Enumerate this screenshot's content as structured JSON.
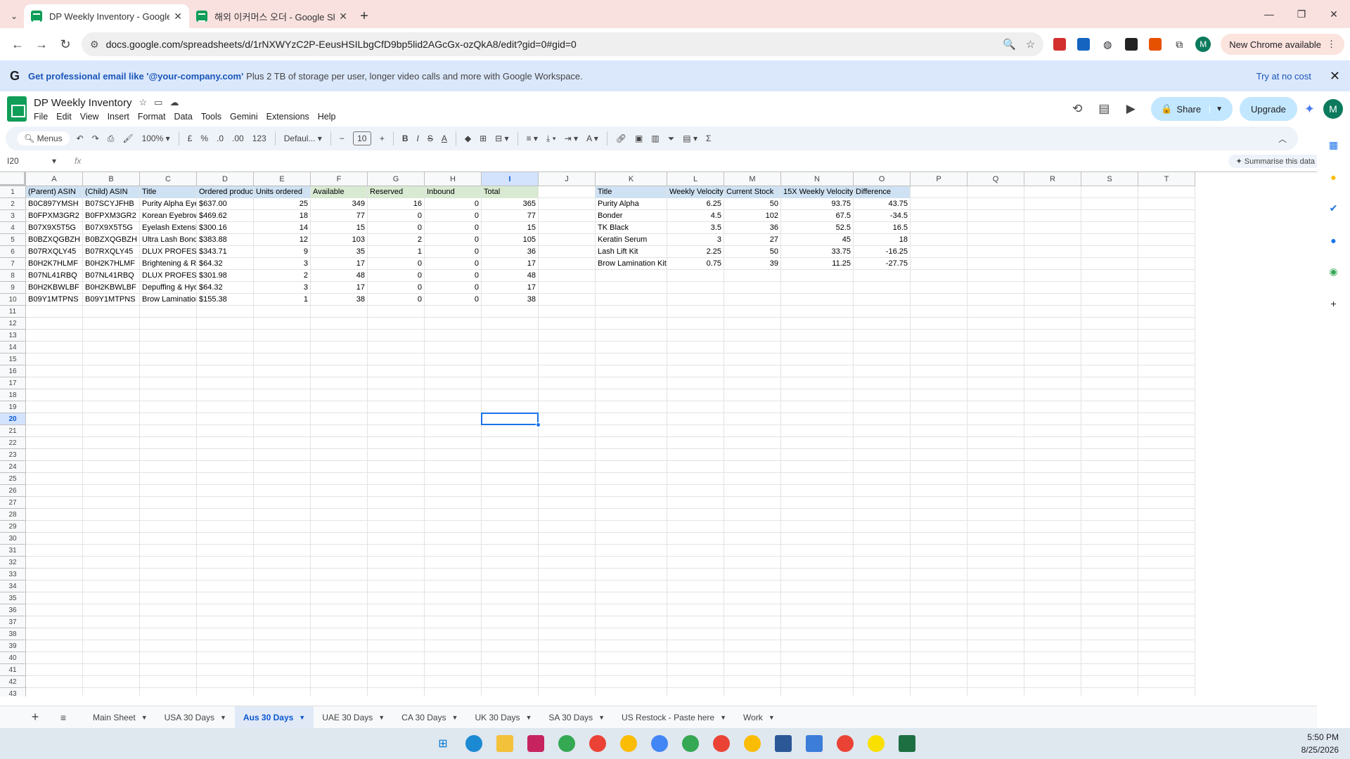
{
  "browser": {
    "tabs": [
      {
        "title": "DP Weekly Inventory - Google S",
        "active": true
      },
      {
        "title": "해외 이커머스 오더 - Google Sh",
        "active": false
      }
    ],
    "url": "docs.google.com/spreadsheets/d/1rNXWYzC2P-EeusHSILbgCfD9bp5lid2AGcGx-ozQkA8/edit?gid=0#gid=0",
    "profile_initial": "M",
    "new_chrome": "New Chrome available"
  },
  "promo": {
    "logo": "G",
    "bold": "Get professional email like '@your-company.com'",
    "text": "Plus 2 TB of storage per user, longer video calls and more with Google Workspace.",
    "cta": "Try at no cost"
  },
  "doc": {
    "title": "DP Weekly Inventory",
    "menu": [
      "File",
      "Edit",
      "View",
      "Insert",
      "Format",
      "Data",
      "Tools",
      "Gemini",
      "Extensions",
      "Help"
    ],
    "share": "Share",
    "upgrade": "Upgrade",
    "avatar": "M"
  },
  "toolbar": {
    "menus": "Menus",
    "zoom": "100%",
    "currency": "£",
    "percent": "%",
    "dec_dec": ".0",
    "dec_inc": ".00",
    "num_fmt": "123",
    "font": "Defaul...",
    "font_size": "10"
  },
  "formula_bar": {
    "name_box": "I20",
    "summarise": "Summarise this data"
  },
  "columns": [
    "A",
    "B",
    "C",
    "D",
    "E",
    "F",
    "G",
    "H",
    "I",
    "J",
    "K",
    "L",
    "M",
    "N",
    "O",
    "P",
    "Q",
    "R",
    "S",
    "T"
  ],
  "selected_col": "I",
  "selected_row": 20,
  "rows_count": 43,
  "headers": {
    "A": "(Parent) ASIN",
    "B": "(Child) ASIN",
    "C": "Title",
    "D": "Ordered product",
    "E": "Units ordered",
    "F": "Available",
    "G": "Reserved",
    "H": "Inbound",
    "I": "Total",
    "K": "Title",
    "L": "Weekly Velocity",
    "M": "Current Stock",
    "N": "15X Weekly Velocity",
    "O": "Difference"
  },
  "table1": [
    [
      "B0C897YMSH",
      "B07SCYJFHB",
      "Purity Alpha Eye",
      "$637.00",
      "25",
      "349",
      "16",
      "0",
      "365"
    ],
    [
      "B0FPXM3GR2",
      "B0FPXM3GR2",
      "Korean Eyebrow",
      "$469.62",
      "18",
      "77",
      "0",
      "0",
      "77"
    ],
    [
      "B07X9X5T5G",
      "B07X9X5T5G",
      "Eyelash Extensi",
      "$300.16",
      "14",
      "15",
      "0",
      "0",
      "15"
    ],
    [
      "B0BZXQGBZH",
      "B0BZXQGBZH",
      "Ultra Lash Bond",
      "$383.88",
      "12",
      "103",
      "2",
      "0",
      "105"
    ],
    [
      "B07RXQLY45",
      "B07RXQLY45",
      "DLUX PROFESS",
      "$343.71",
      "9",
      "35",
      "1",
      "0",
      "36"
    ],
    [
      "B0H2K7HLMF",
      "B0H2K7HLMF",
      "Brightening & Re",
      "$64.32",
      "3",
      "17",
      "0",
      "0",
      "17"
    ],
    [
      "B07NL41RBQ",
      "B07NL41RBQ",
      "DLUX PROFESS",
      "$301.98",
      "2",
      "48",
      "0",
      "0",
      "48"
    ],
    [
      "B0H2KBWLBF",
      "B0H2KBWLBF",
      "Depuffing & Hyd",
      "$64.32",
      "3",
      "17",
      "0",
      "0",
      "17"
    ],
    [
      "B09Y1MTPNS",
      "B09Y1MTPNS",
      "Brow Lamination",
      "$155.38",
      "1",
      "38",
      "0",
      "0",
      "38"
    ]
  ],
  "table2": [
    [
      "Purity Alpha",
      "6.25",
      "50",
      "93.75",
      "43.75"
    ],
    [
      "Bonder",
      "4.5",
      "102",
      "67.5",
      "-34.5"
    ],
    [
      "TK Black",
      "3.5",
      "36",
      "52.5",
      "16.5"
    ],
    [
      "Keratin Serum",
      "3",
      "27",
      "45",
      "18"
    ],
    [
      "Lash Lift Kit",
      "2.25",
      "50",
      "33.75",
      "-16.25"
    ],
    [
      "Brow Lamination Kit",
      "0.75",
      "39",
      "11.25",
      "-27.75"
    ]
  ],
  "colors": {
    "header_blue": "#cfe2f3",
    "header_green": "#d9ead3",
    "selection": "#1a73e8"
  },
  "sheets": [
    {
      "name": "Main Sheet",
      "active": false
    },
    {
      "name": "USA 30 Days",
      "active": false
    },
    {
      "name": "Aus 30 Days",
      "active": true
    },
    {
      "name": "UAE 30 Days",
      "active": false
    },
    {
      "name": "CA 30 Days",
      "active": false
    },
    {
      "name": "UK 30 Days",
      "active": false
    },
    {
      "name": "SA 30 Days",
      "active": false
    },
    {
      "name": "US Restock - Paste here",
      "active": false
    },
    {
      "name": "Work",
      "active": false
    }
  ],
  "clock": {
    "time": "5:50 PM",
    "date": "8/25/2026"
  }
}
